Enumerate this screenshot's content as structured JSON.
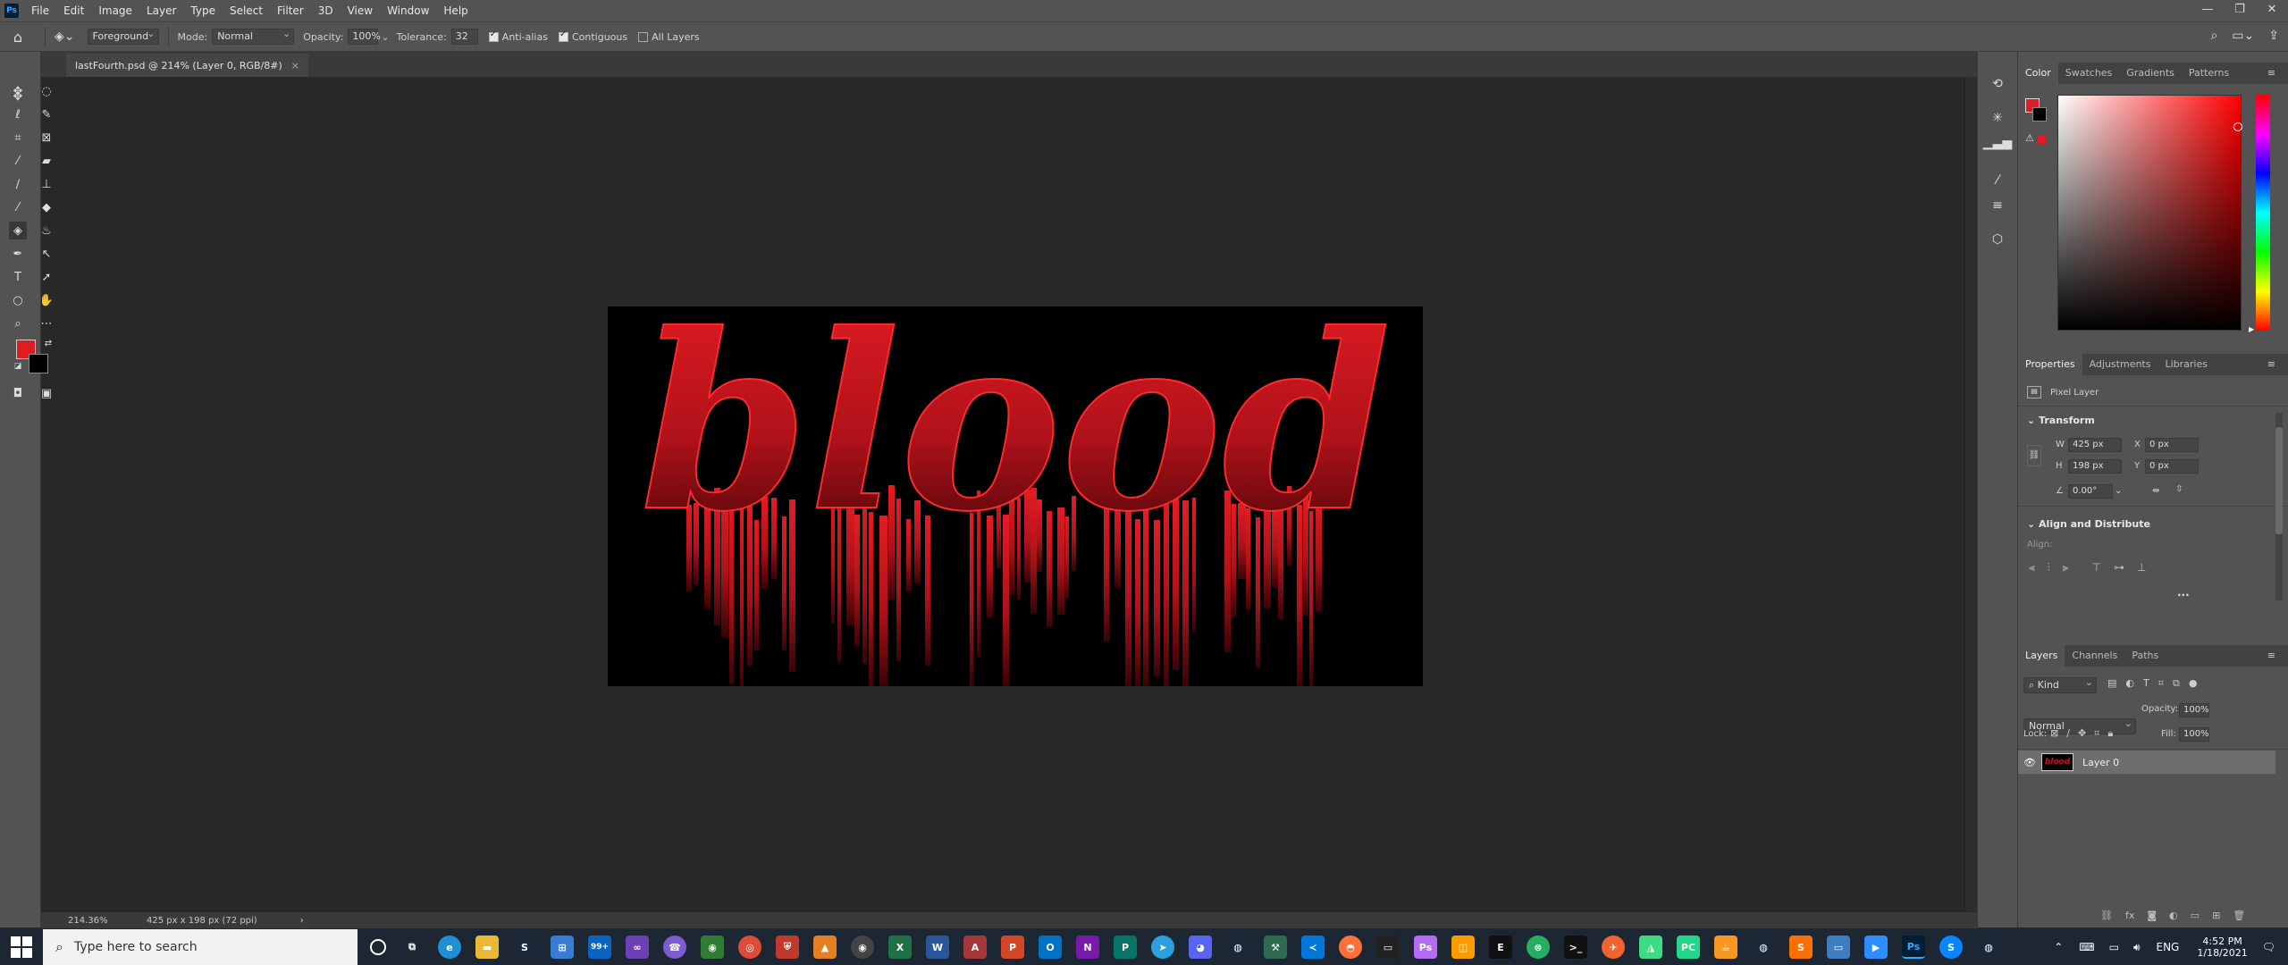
{
  "app": {
    "logo_text": "Ps",
    "menu": [
      "File",
      "Edit",
      "Image",
      "Layer",
      "Type",
      "Select",
      "Filter",
      "3D",
      "View",
      "Window",
      "Help"
    ],
    "window_controls": [
      "—",
      "❐",
      "✕"
    ]
  },
  "options_bar": {
    "fill_source": "Foreground",
    "mode_label": "Mode:",
    "mode_value": "Normal",
    "opacity_label": "Opacity:",
    "opacity_value": "100%",
    "tolerance_label": "Tolerance:",
    "tolerance_value": "32",
    "antialias_label": "Anti-alias",
    "antialias_checked": true,
    "contiguous_label": "Contiguous",
    "contiguous_checked": true,
    "alllayers_label": "All Layers",
    "alllayers_checked": false
  },
  "document": {
    "tab_title": "lastFourth.psd @ 214% (Layer 0, RGB/8#)",
    "close": "×",
    "artwork_text": "blood"
  },
  "status": {
    "zoom": "214.36%",
    "dimensions": "425 px x 198 px (72 ppi)",
    "arrow": "›"
  },
  "colors": {
    "foreground": "#e01b22",
    "background": "#000000",
    "picker_hue": "#ff0000",
    "blood_red": "#c8141b"
  },
  "color_panel": {
    "tabs": [
      "Color",
      "Swatches",
      "Gradients",
      "Patterns"
    ],
    "active": "Color"
  },
  "properties_panel": {
    "tabs": [
      "Properties",
      "Adjustments",
      "Libraries"
    ],
    "active": "Properties",
    "layer_type": "Pixel Layer",
    "transform_title": "Transform",
    "w_label": "W",
    "w_value": "425 px",
    "h_label": "H",
    "h_value": "198 px",
    "x_label": "X",
    "x_value": "0 px",
    "y_label": "Y",
    "y_value": "0 px",
    "angle_value": "0.00°",
    "align_title": "Align and Distribute",
    "align_label": "Align:",
    "more": "..."
  },
  "layers_panel": {
    "tabs": [
      "Layers",
      "Channels",
      "Paths"
    ],
    "active": "Layers",
    "kind_label": "Kind",
    "blend_mode": "Normal",
    "opacity_label": "Opacity:",
    "opacity_value": "100%",
    "lock_label": "Lock:",
    "fill_label": "Fill:",
    "fill_value": "100%",
    "layers": [
      {
        "name": "Layer 0",
        "visible": true
      }
    ]
  },
  "taskbar": {
    "search_placeholder": "Type here to search",
    "language": "ENG",
    "time": "4:52 PM",
    "date": "1/18/2021",
    "mail_badge": "99+"
  }
}
